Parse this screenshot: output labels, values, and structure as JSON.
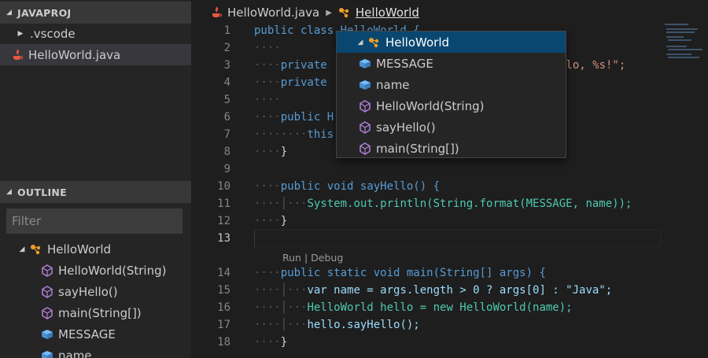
{
  "colors": {
    "class_icon": "#ee9d28",
    "field_icon": "#75beff",
    "method_icon": "#b180d7",
    "java_icon": "#e8563f",
    "selection": "#094771"
  },
  "explorer": {
    "title": "JAVAPROJ",
    "items": [
      {
        "label": ".vscode",
        "icon": "folder-chevron-icon"
      },
      {
        "label": "HelloWorld.java",
        "icon": "java-file-icon"
      }
    ]
  },
  "outline": {
    "title": "OUTLINE",
    "filter_placeholder": "Filter",
    "items": [
      {
        "label": "HelloWorld",
        "icon": "class-icon"
      },
      {
        "label": "HelloWorld(String)",
        "icon": "method-icon"
      },
      {
        "label": "sayHello()",
        "icon": "method-icon"
      },
      {
        "label": "main(String[])",
        "icon": "method-icon"
      },
      {
        "label": "MESSAGE",
        "icon": "field-icon"
      },
      {
        "label": "name",
        "icon": "field-icon"
      }
    ]
  },
  "breadcrumb": {
    "file": "HelloWorld.java",
    "symbol": "HelloWorld"
  },
  "editor": {
    "line_numbers": [
      "1",
      "2",
      "3",
      "4",
      "5",
      "6",
      "7",
      "8",
      "9",
      "10",
      "11",
      "12",
      "13",
      "14",
      "15",
      "16",
      "17",
      "18"
    ],
    "codelens": {
      "run": "Run",
      "separator": " | ",
      "debug": "Debug"
    },
    "code": {
      "l1": "public class HelloWorld {",
      "l3a": "private ",
      "l3b": "llo, %s!\";",
      "l4": "private ",
      "l6": "public H",
      "l7": "this",
      "l8": "}",
      "l10": "public void sayHello() {",
      "l11": "System.out.println(String.format(MESSAGE, name));",
      "l12": "}",
      "l14": "public static void main(String[] args) {",
      "l15": "var name = args.length > 0 ? args[0] : \"Java\";",
      "l16": "HelloWorld hello = new HelloWorld(name);",
      "l17": "hello.sayHello();",
      "l18": "}"
    }
  },
  "dropdown": {
    "items": [
      {
        "label": "HelloWorld",
        "icon": "class-icon",
        "selected": true
      },
      {
        "label": "MESSAGE",
        "icon": "field-icon"
      },
      {
        "label": "name",
        "icon": "field-icon"
      },
      {
        "label": "HelloWorld(String)",
        "icon": "method-icon"
      },
      {
        "label": "sayHello()",
        "icon": "method-icon"
      },
      {
        "label": "main(String[])",
        "icon": "method-icon"
      }
    ]
  }
}
